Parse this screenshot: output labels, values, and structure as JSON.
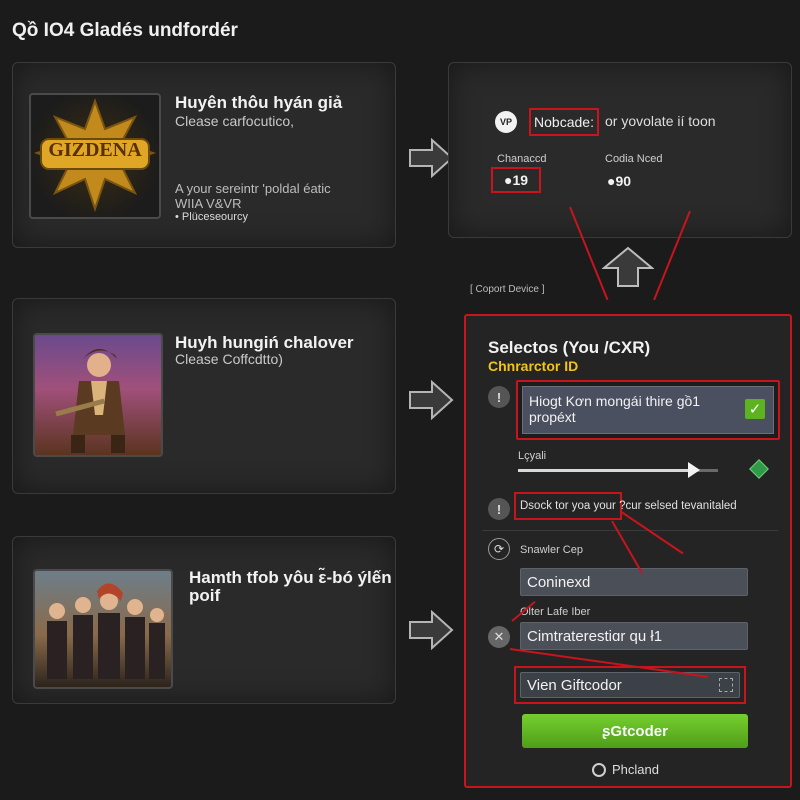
{
  "page": {
    "title": "Qồ IO4 Gladés undfordér"
  },
  "games": [
    {
      "title": "Huyên thôu hyán giả",
      "subtitle": "Clease carfocutico,",
      "description": "A your sereintr 'poldal éatic\nWIIA V&VR",
      "bullet": "Plüceseourcy",
      "logo_text": "GIZDENA"
    },
    {
      "title": "Huyh hungiń chalover",
      "subtitle": "Clease Coffcdtto)"
    },
    {
      "title": "Hamth tfob yôu ε̃-bó ýlến\npoif",
      "subtitle": ""
    }
  ],
  "info_panel": {
    "badge_icon_text": "VP",
    "nobode_label": "Nobcade:",
    "nobode_suffix": "or yovolate ií toon",
    "charaged_label": "Chanaccd",
    "charaged_value": "●19",
    "code_label": "Codia Nced",
    "code_value": "●90"
  },
  "support_label": "[ Coport Device ]",
  "form": {
    "title": "Selectos (You /CXR)",
    "subtitle": "Chnrarctor ID",
    "character_value": "Hiogt Kơn mongái thire gồ1\npropéxt",
    "level_label": "Lçyali",
    "slider_level": 0.88,
    "check_label": "Dsock tor yoa your ?cur selsed tevanitaled",
    "server_label": "Snawler Cep",
    "server_value": "Coninexd",
    "other_label": "Olter Lafe Iber",
    "character_field_value": "Cimtraterestiɑr qu ł1",
    "giftcode_value": "Vien Giftcodor",
    "submit_label": "ʂGtcoder",
    "photo_label": "Phcland"
  },
  "colors": {
    "accent_red": "#c8141c",
    "accent_green": "#5db31f",
    "form_title_yellow": "#f0c418"
  }
}
